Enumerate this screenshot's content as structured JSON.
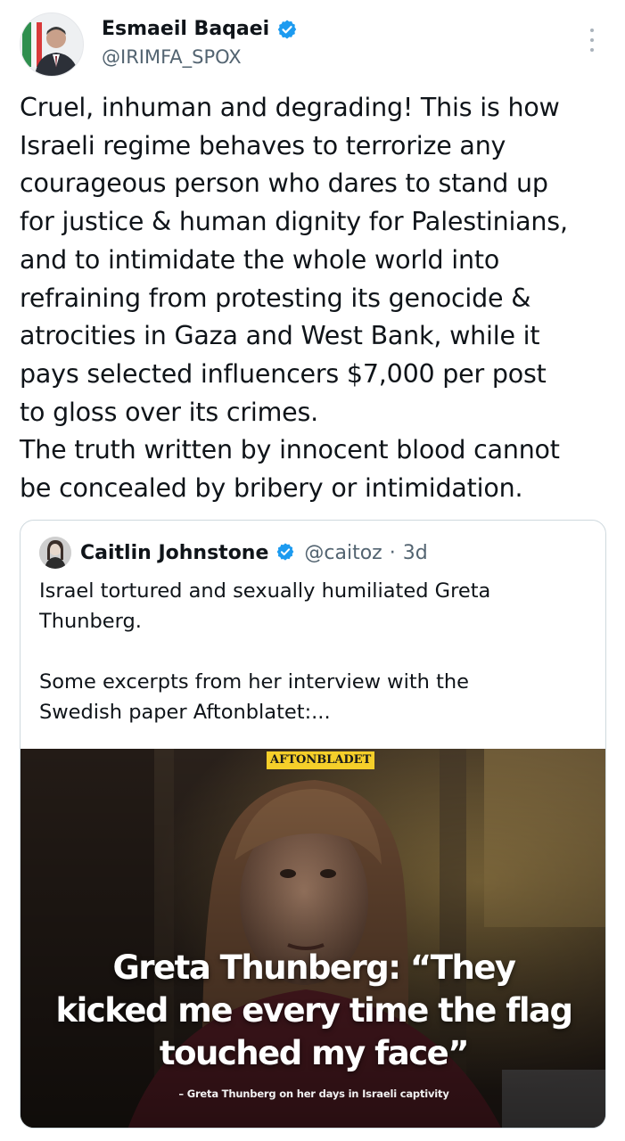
{
  "author": {
    "name": "Esmaeil Baqaei",
    "handle": "@IRIMFA_SPOX",
    "verified_color": "#1d9bf0"
  },
  "tweet": {
    "text": "Cruel, inhuman and degrading! This is how\nIsraeli regime behaves to terrorize any\ncourageous person who dares to stand up\nfor justice & human dignity for Palestinians,\nand to intimidate the whole world into\nrefraining from protesting its genocide &\natrocities in Gaza and West Bank, while it\npays selected influencers $7,000 per post\nto gloss over its crimes.\nThe truth written by innocent blood cannot\nbe concealed by bribery or intimidation."
  },
  "quoted": {
    "name": "Caitlin Johnstone",
    "handle": "@caitoz",
    "separator": "·",
    "time": "3d",
    "text": "Israel tortured and sexually humiliated Greta\nThunberg.\n\nSome excerpts from her interview with the\nSwedish paper Aftonblatet:...",
    "media": {
      "brand": "AFTONBLADET",
      "headline": "Greta Thunberg: “They\nkicked me every time the flag\ntouched my face”",
      "caption": "– Greta Thunberg on her days in Israeli captivity"
    }
  },
  "icons": {
    "verified": "verified-badge-icon",
    "more": "more-options-icon"
  }
}
